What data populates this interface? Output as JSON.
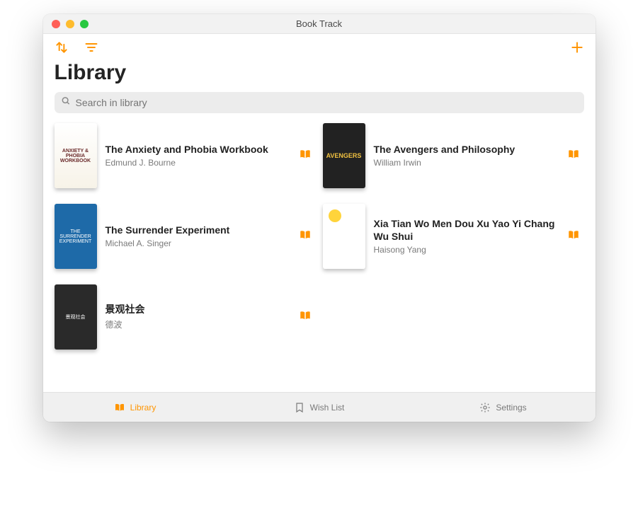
{
  "window": {
    "title": "Book Track"
  },
  "colors": {
    "accent": "#ff9500"
  },
  "header": {
    "heading": "Library"
  },
  "search": {
    "placeholder": "Search in library",
    "value": ""
  },
  "books": [
    {
      "title": "The Anxiety and Phobia Workbook",
      "author": "Edmund J. Bourne",
      "coverClass": "bk1",
      "coverLabel": "ANXIETY & PHOBIA WORKBOOK"
    },
    {
      "title": "The Avengers and Philosophy",
      "author": "William Irwin",
      "coverClass": "bk2",
      "coverLabel": "AVENGERS"
    },
    {
      "title": "The Surrender Experiment",
      "author": "Michael A. Singer",
      "coverClass": "bk3",
      "coverLabel": "THE SURRENDER EXPERIMENT"
    },
    {
      "title": "Xia Tian Wo Men Dou Xu Yao Yi Chang Wu Shui",
      "author": "Haisong Yang",
      "coverClass": "bk4",
      "coverLabel": ""
    },
    {
      "title": "景观社会",
      "author": "德波",
      "coverClass": "bk5",
      "coverLabel": "景观社会"
    }
  ],
  "tabs": {
    "library": "Library",
    "wishlist": "Wish List",
    "settings": "Settings",
    "active": "library"
  }
}
